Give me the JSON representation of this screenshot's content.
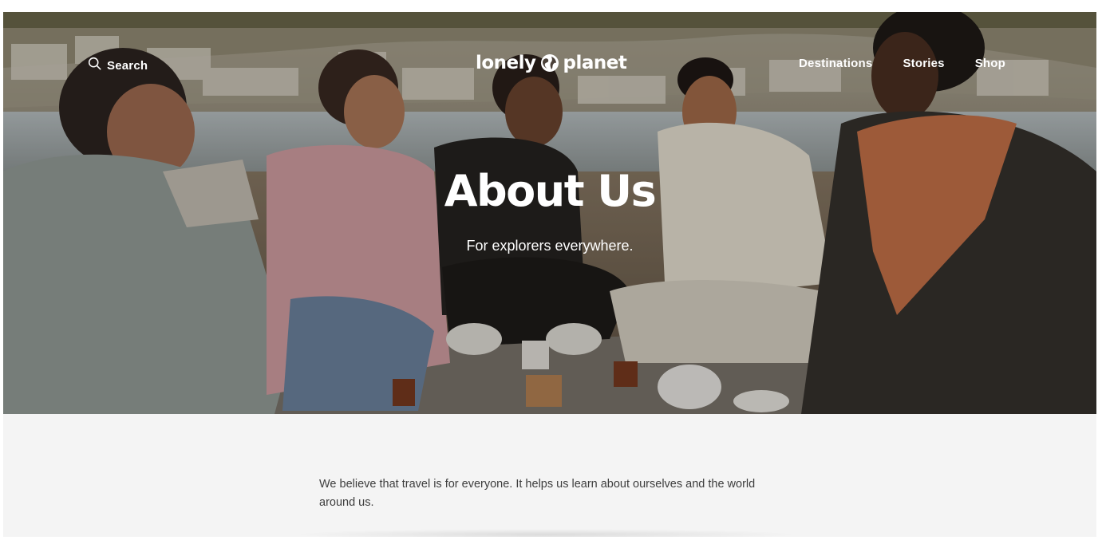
{
  "nav": {
    "search_label": "Search",
    "logo_text_left": "lonely",
    "logo_text_right": "planet",
    "links": [
      "Destinations",
      "Stories",
      "Shop"
    ]
  },
  "hero": {
    "title": "About Us",
    "subtitle": "For explorers everywhere."
  },
  "intro": {
    "text": "We believe that travel is for everyone. It helps us learn about ourselves and the world around us."
  },
  "icons": {
    "search": "search-icon",
    "logo_globe": "globe-icon"
  },
  "colors": {
    "hero_text": "#ffffff",
    "body_background": "#f4f4f4",
    "body_text": "#3d3d3d"
  }
}
